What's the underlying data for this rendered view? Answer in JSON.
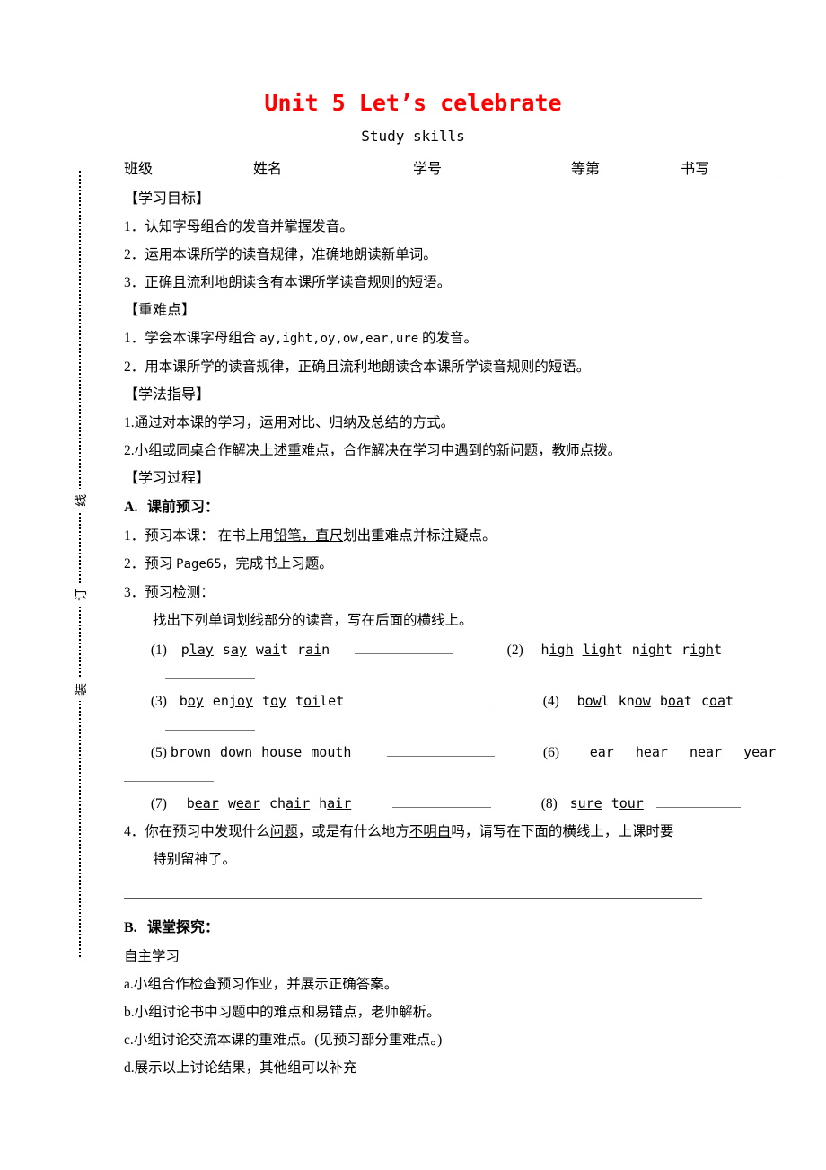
{
  "document": {
    "title": "Unit 5 Let’s celebrate",
    "subtitle": "Study skills",
    "title_color": "#FF0000"
  },
  "binding_marks": [
    "线",
    "订",
    "装"
  ],
  "info_fields": [
    {
      "label": "班级",
      "value": ""
    },
    {
      "label": "姓名",
      "value": ""
    },
    {
      "label": "学号",
      "value": ""
    },
    {
      "label": "等第",
      "value": ""
    },
    {
      "label": "书写",
      "value": ""
    }
  ],
  "objectives": {
    "heading": "【学习目标】",
    "items": [
      "1．认知字母组合的发音并掌握发音。",
      "2．运用本课所学的读音规律，准确地朗读新单词。",
      "3．正确且流利地朗读含有本课所学读音规则的短语。"
    ]
  },
  "key_points": {
    "heading": "【重难点】",
    "item1_pre": "1．学会本课字母组合 ",
    "item1_mono": "ay,ight,oy,ow,ear,ure",
    "item1_post": " 的发音。",
    "item2": "2．用本课所学的读音规律，正确且流利地朗读含本课所学读音规则的短语。"
  },
  "method_guide": {
    "heading": "【学法指导】",
    "items": [
      "1.通过对本课的学习，运用对比、归纳及总结的方式。",
      "2.小组或同桌合作解决上述重难点，合作解决在学习中遇到的新问题，教师点拨。"
    ]
  },
  "process": {
    "heading": "【学习过程】",
    "section_a": {
      "label": "A.",
      "title": "课前预习："
    },
    "step1_pre": "1．预习本课： 在书上用",
    "step1_underline": "铅笔，直尺",
    "step1_post": "划出重难点并标注疑点。",
    "step2_pre": "2．预习 ",
    "step2_mono": "Page65",
    "step2_post": "，完成书上习题。",
    "step3": "3．预习检测：",
    "step3_sub": "找出下列单词划线部分的读音，写在后面的横线上。",
    "exercises": [
      {
        "index": "(1)",
        "words": [
          {
            "pre": "p",
            "mark": "lay",
            "post": ""
          },
          {
            "pre": "s",
            "mark": "ay",
            "post": ""
          },
          {
            "pre": "w",
            "mark": "ai",
            "post": "t"
          },
          {
            "pre": "r",
            "mark": "ai",
            "post": "n"
          }
        ]
      },
      {
        "index": "(2)",
        "words": [
          {
            "pre": "h",
            "mark": "igh",
            "post": ""
          },
          {
            "pre": "",
            "mark": "ligh",
            "post": "t"
          },
          {
            "pre": "n",
            "mark": "igh",
            "post": "t"
          },
          {
            "pre": "r",
            "mark": "igh",
            "post": "t"
          }
        ]
      },
      {
        "index": "(3)",
        "words": [
          {
            "pre": "b",
            "mark": "oy",
            "post": ""
          },
          {
            "pre": "en",
            "mark": "joy",
            "post": ""
          },
          {
            "pre": "t",
            "mark": "oy",
            "post": ""
          },
          {
            "pre": "t",
            "mark": "oi",
            "post": "let"
          }
        ]
      },
      {
        "index": "(4)",
        "words": [
          {
            "pre": "b",
            "mark": "ow",
            "post": "l"
          },
          {
            "pre": "kn",
            "mark": "ow",
            "post": ""
          },
          {
            "pre": "b",
            "mark": "oa",
            "post": "t"
          },
          {
            "pre": "c",
            "mark": "oa",
            "post": "t"
          }
        ]
      },
      {
        "index": "(5)",
        "words": [
          {
            "pre": "br",
            "mark": "own",
            "post": ""
          },
          {
            "pre": "d",
            "mark": "own",
            "post": ""
          },
          {
            "pre": "h",
            "mark": "ou",
            "post": "se"
          },
          {
            "pre": "m",
            "mark": "ou",
            "post": "th"
          }
        ]
      },
      {
        "index": "(6)",
        "words": [
          {
            "pre": "",
            "mark": "ear",
            "post": ""
          },
          {
            "pre": "h",
            "mark": "ear",
            "post": ""
          },
          {
            "pre": "n",
            "mark": "ear",
            "post": ""
          },
          {
            "pre": "y",
            "mark": "ear",
            "post": ""
          }
        ]
      },
      {
        "index": "(7)",
        "words": [
          {
            "pre": "b",
            "mark": "ear",
            "post": ""
          },
          {
            "pre": "w",
            "mark": "ear",
            "post": ""
          },
          {
            "pre": "ch",
            "mark": "air",
            "post": ""
          },
          {
            "pre": "h",
            "mark": "air",
            "post": ""
          }
        ]
      },
      {
        "index": "(8)",
        "words": [
          {
            "pre": "s",
            "mark": "ure",
            "post": ""
          },
          {
            "pre": "t",
            "mark": "our",
            "post": ""
          }
        ]
      }
    ],
    "step4_pre": "4．你在预习中发现什么",
    "step4_u1": "问题",
    "step4_mid": "，或是有什么地方",
    "step4_u2": "不明白",
    "step4_post": "吗，请写在下面的横线上，上课时要",
    "step4_line2": "特别留神了。",
    "section_b": {
      "label": "B.",
      "title": "课堂探究："
    },
    "b_subtitle": "自主学习",
    "b_items": [
      "a.小组合作检查预习作业，并展示正确答案。",
      "b.小组讨论书中习题中的难点和易错点，老师解析。",
      "c.小组讨论交流本课的重难点。(见预习部分重难点。)",
      "d.展示以上讨论结果，其他组可以补充"
    ]
  }
}
